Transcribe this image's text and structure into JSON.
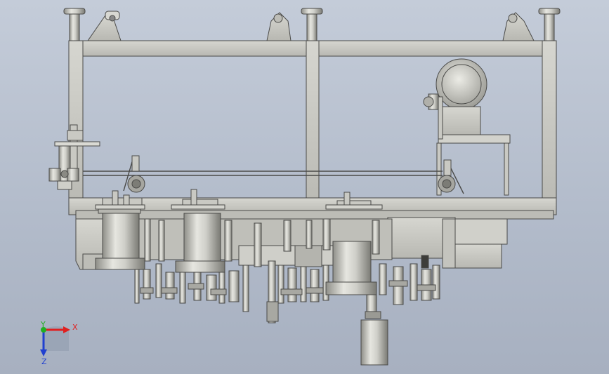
{
  "triad": {
    "x_label": "X",
    "y_label": "Y",
    "z_label": "Z",
    "x_color": "#e02020",
    "y_color": "#20b020",
    "z_color": "#2040d0"
  },
  "colors": {
    "background_top": "#c4ccd9",
    "background_bottom": "#a7b0c0",
    "metal": "#c9c9c3",
    "edge": "#4a4a48"
  }
}
